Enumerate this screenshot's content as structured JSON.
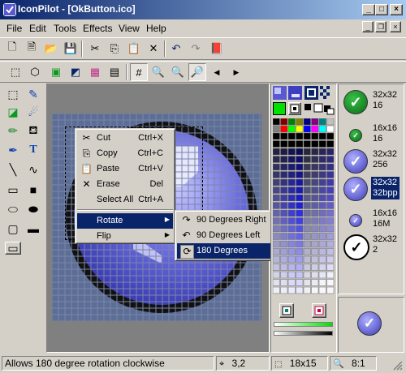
{
  "window": {
    "title": "IconPilot - [OkButton.ico]",
    "minimize_glyph": "_",
    "maximize_glyph": "□",
    "close_glyph": "×"
  },
  "menubar": {
    "items": [
      "File",
      "Edit",
      "Tools",
      "Effects",
      "View",
      "Help"
    ],
    "mdi_minimize_glyph": "_",
    "mdi_restore_glyph": "❐",
    "mdi_close_glyph": "×"
  },
  "toolbar1": {
    "icons": [
      "new-icon",
      "new-from-image-icon",
      "open-icon",
      "save-icon",
      "cut-icon",
      "copy-icon",
      "paste-icon",
      "delete-icon",
      "undo-icon",
      "redo-icon",
      "library-icon"
    ],
    "glyphs": [
      "🗋",
      "🗎",
      "📂",
      "💾",
      "✂",
      "⎘",
      "📋",
      "✕",
      "↶",
      "↷",
      "📕"
    ]
  },
  "toolbar2": {
    "icons": [
      "select-all-icon",
      "3d-cube-icon",
      "frame-green-icon",
      "color-swap-icon",
      "palette-icon",
      "transparency-icon",
      "grid-icon",
      "zoom-in-icon",
      "zoom-out-icon",
      "zoom-fit-icon",
      "prev-format-icon",
      "next-format-icon"
    ],
    "glyphs": [
      "⬚",
      "⬡",
      "▣",
      "◩",
      "▦",
      "▤",
      "#",
      "🔍",
      "🔍",
      "🔎",
      "◀",
      "▶"
    ]
  },
  "tools": {
    "icons": [
      "rect-select-icon",
      "eyedropper-icon",
      "eraser-icon",
      "spray-icon",
      "pencil-icon",
      "fill-icon",
      "brush-icon",
      "text-icon",
      "line-icon",
      "curve-icon",
      "rectangle-icon",
      "filled-rectangle-icon",
      "ellipse-icon",
      "filled-ellipse-icon",
      "rounded-rect-icon",
      "filled-rounded-rect-icon",
      "tool-option-icon"
    ],
    "glyphs": [
      "⬚",
      "✎",
      "◪",
      "☄",
      "✏",
      "⛾",
      "✒",
      "T",
      "╲",
      "∿",
      "▭",
      "■",
      "⬭",
      "⬬",
      "▢",
      "▬",
      "▭"
    ]
  },
  "context_menu": {
    "items": [
      {
        "icon": "cut-icon",
        "glyph": "✂",
        "label": "Cut",
        "shortcut": "Ctrl+X"
      },
      {
        "icon": "copy-icon",
        "glyph": "⎘",
        "label": "Copy",
        "shortcut": "Ctrl+C"
      },
      {
        "icon": "paste-icon",
        "glyph": "📋",
        "label": "Paste",
        "shortcut": "Ctrl+V"
      },
      {
        "icon": "erase-icon",
        "glyph": "✕",
        "label": "Erase",
        "shortcut": "Del"
      },
      {
        "icon": "",
        "glyph": "",
        "label": "Select All",
        "shortcut": "Ctrl+A"
      }
    ],
    "rotate_label": "Rotate",
    "flip_label": "Flip",
    "arrow_glyph": "▶"
  },
  "rotate_submenu": {
    "items": [
      {
        "icon": "rotate-right-icon",
        "glyph": "↷",
        "label": "90 Degrees Right"
      },
      {
        "icon": "rotate-left-icon",
        "glyph": "↶",
        "label": "90 Degrees Left"
      },
      {
        "icon": "rotate-180-icon",
        "glyph": "⟳",
        "label": "180 Degrees"
      }
    ],
    "selected_index": 2
  },
  "formats": [
    {
      "size": "32x32",
      "depth": "16",
      "icon_size": 28,
      "dark": false
    },
    {
      "size": "16x16",
      "depth": "16",
      "icon_size": 14,
      "dark": false
    },
    {
      "size": "32x32",
      "depth": "256",
      "icon_size": 28,
      "dark": false
    },
    {
      "size": "32x32",
      "depth": "32bpp",
      "icon_size": 28,
      "dark": false,
      "selected": true
    },
    {
      "size": "16x16",
      "depth": "16M",
      "icon_size": 14,
      "dark": false
    },
    {
      "size": "32x32",
      "depth": "2",
      "icon_size": 28,
      "dark": false
    }
  ],
  "check_glyph": "✓",
  "status": {
    "message": "Allows 180 degree rotation clockwise",
    "cursor_pos": "3,2",
    "selection_size": "18x15",
    "zoom": "8:1"
  },
  "colors": {
    "accent": "#0a246a",
    "icon_blue": "#4b4bd0",
    "icon_light": "#9c9cf0",
    "ok_green": "#0b7d1e",
    "canvas_bg": "#808080"
  }
}
